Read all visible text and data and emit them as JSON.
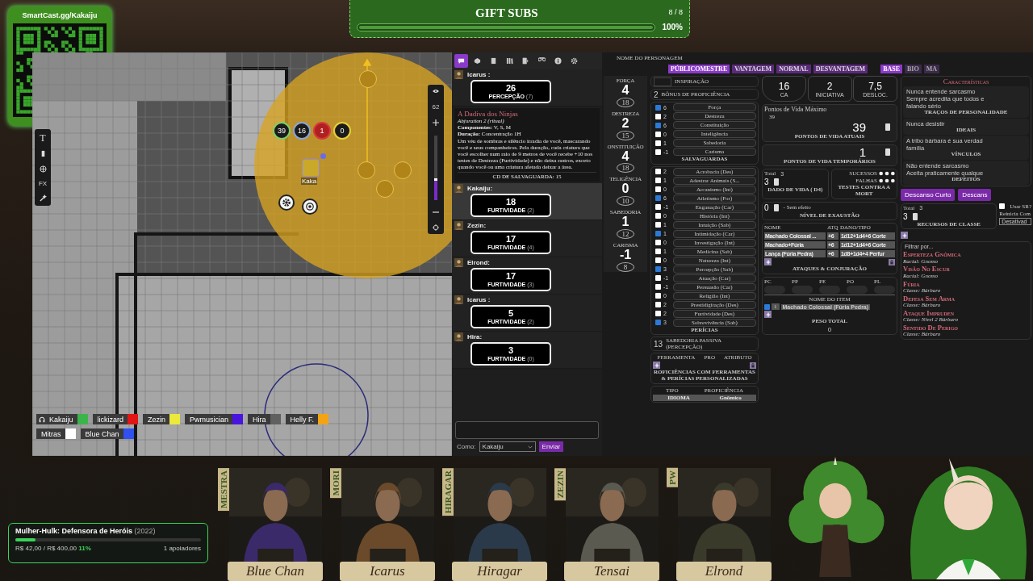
{
  "qr_card": {
    "caption": "SmartCast.gg/Kakaiju"
  },
  "gift_subs": {
    "title": "GIFT SUBS",
    "count": "8 / 8",
    "level": 1,
    "percent": "100%"
  },
  "map": {
    "tools": [
      {
        "kind": "text",
        "label": "T"
      },
      {
        "kind": "rect"
      },
      {
        "kind": "globe"
      },
      {
        "kind": "fx",
        "label": "FX"
      },
      {
        "kind": "wand"
      }
    ],
    "token_bubbles": [
      {
        "value": "39",
        "color": "#7ccf6a"
      },
      {
        "value": "16",
        "color": "#8aa6d8"
      },
      {
        "value": "1",
        "color": "#d63a3a"
      },
      {
        "value": "0",
        "color": "#e8cf3a"
      }
    ],
    "token_label": "Kaka",
    "zoom": {
      "value": "62",
      "level": 0.3
    },
    "players": [
      {
        "name": "Kakaiju",
        "color": "#3bb54a",
        "speaking": true
      },
      {
        "name": "lickizard",
        "color": "#e31414",
        "speaking": false
      },
      {
        "name": "Zezin",
        "color": "#ece83c",
        "speaking": false
      },
      {
        "name": "Pwmusician",
        "color": "#4a14e0",
        "speaking": false
      },
      {
        "name": "Hira",
        "color": "#606060",
        "speaking": false
      },
      {
        "name": "Helly F.",
        "color": "#f2a414",
        "speaking": false
      },
      {
        "name": "Mitras",
        "color": "#ffffff",
        "speaking": false
      },
      {
        "name": "Blue Chan",
        "color": "#3050f0",
        "speaking": false
      }
    ]
  },
  "chat": {
    "tabs": [
      {
        "kind": "chat",
        "selected": true
      },
      {
        "kind": "dice",
        "selected": false
      },
      {
        "kind": "journal",
        "selected": false
      },
      {
        "kind": "compendium",
        "selected": false
      },
      {
        "kind": "jukebox",
        "selected": false
      },
      {
        "kind": "collections",
        "selected": false
      },
      {
        "kind": "info",
        "selected": false
      },
      {
        "kind": "settings",
        "selected": false
      }
    ],
    "messages": [
      {
        "kind": "roll",
        "speaker": "Icarus :",
        "total": "26",
        "label": "PERCEPÇÃO",
        "mod": "(7)",
        "highlighted": false
      },
      {
        "kind": "spell",
        "title": "A Dadiva dos Ninjas",
        "subtitle": "Abjuration 2 (ritual)",
        "components": "**Componentes:** V, S, M",
        "duration": "**Duração:** Concentração 1H",
        "body": "Um véu de sombras e silêncio irradia de você, mascarando você e seus companheiros. Pela duração, cada criatura que você escolher num raio de 9 metros de você recebe +10 nos testes de Destreza (Furtividade) e não deixa rastros, exceto quando você ou uma criatura afetada deixar a área.",
        "save": "CD DE SALVAGUARDA: 15"
      },
      {
        "kind": "roll",
        "speaker": "Kakaiju:",
        "total": "18",
        "label": "FURTIVIDADE",
        "mod": "(2)",
        "highlighted": true
      },
      {
        "kind": "roll",
        "speaker": "Zezin:",
        "total": "17",
        "label": "FURTIVIDADE",
        "mod": "(4)",
        "highlighted": false
      },
      {
        "kind": "roll",
        "speaker": "Elrond:",
        "total": "17",
        "label": "FURTIVIDADE",
        "mod": "(3)",
        "highlighted": false
      },
      {
        "kind": "roll",
        "speaker": "Icarus :",
        "total": "5",
        "label": "FURTIVIDADE",
        "mod": "(2)",
        "highlighted": false
      },
      {
        "kind": "roll",
        "speaker": "Hira:",
        "total": "3",
        "label": "FURTIVIDADE",
        "mod": "(0)",
        "highlighted": false
      }
    ],
    "as_label": "Como:",
    "as_value": "Kakaiju",
    "send": "Enviar"
  },
  "sheet": {
    "name_label": "NOME DO PERSONAGEM",
    "roll_modes": [
      {
        "label": "PÚBLICOMESTRE",
        "selected": true
      },
      {
        "label": "VANTAGEM",
        "selected": false
      },
      {
        "label": "NORMAL",
        "selected": false
      },
      {
        "label": "DESVANTAGEM",
        "selected": false
      }
    ],
    "sheet_tabs": [
      {
        "label": "BASE",
        "selected": true
      },
      {
        "label": "BIO",
        "selected": false
      },
      {
        "label": "MA",
        "selected": false
      }
    ],
    "abilities": [
      {
        "name": "FORÇA",
        "mod": "4",
        "score": "18"
      },
      {
        "name": "DESTREZA",
        "mod": "2",
        "score": "15"
      },
      {
        "name": "ONSTITUIÇÃO",
        "mod": "4",
        "score": "18"
      },
      {
        "name": "TELIGÊNCIA",
        "mod": "0",
        "score": "10"
      },
      {
        "name": "SABEDORIA",
        "mod": "1",
        "score": "12"
      },
      {
        "name": "CARISMA",
        "mod": "-1",
        "score": "8"
      }
    ],
    "inspiration": "INSPIRAÇÃO",
    "proficiency": {
      "value": "2",
      "label": "BÔNUS DE PROFICIÊNCIA"
    },
    "saves": {
      "title": "SALVAGUARDAS",
      "items": [
        {
          "checked": true,
          "mod": "6",
          "name": "Força"
        },
        {
          "checked": false,
          "mod": "2",
          "name": "Destreza"
        },
        {
          "checked": true,
          "mod": "6",
          "name": "Constituição"
        },
        {
          "checked": false,
          "mod": "0",
          "name": "Inteligência"
        },
        {
          "checked": false,
          "mod": "1",
          "name": "Sabedoria"
        },
        {
          "checked": false,
          "mod": "-1",
          "name": "Carisma"
        }
      ]
    },
    "skills": {
      "title": "PERÍCIAS",
      "items": [
        {
          "checked": false,
          "mod": "2",
          "name": "Acrobacia (Des)"
        },
        {
          "checked": false,
          "mod": "1",
          "name": "Adestrar Animais (S..."
        },
        {
          "checked": false,
          "mod": "0",
          "name": "Arcanismo (Int)"
        },
        {
          "checked": true,
          "mod": "6",
          "name": "Atletismo (For)"
        },
        {
          "checked": false,
          "mod": "-1",
          "name": "Enganação (Car)"
        },
        {
          "checked": false,
          "mod": "0",
          "name": "História (Int)"
        },
        {
          "checked": false,
          "mod": "1",
          "name": "Intuição (Sab)"
        },
        {
          "checked": true,
          "mod": "1",
          "name": "Intimidação (Car)"
        },
        {
          "checked": false,
          "mod": "0",
          "name": "Investigação (Int)"
        },
        {
          "checked": false,
          "mod": "1",
          "name": "Medicina (Sab)"
        },
        {
          "checked": false,
          "mod": "0",
          "name": "Natureza (Int)"
        },
        {
          "checked": true,
          "mod": "3",
          "name": "Percepção (Sab)"
        },
        {
          "checked": false,
          "mod": "-1",
          "name": "Atuação (Car)"
        },
        {
          "checked": false,
          "mod": "-1",
          "name": "Persuasão (Car)"
        },
        {
          "checked": false,
          "mod": "0",
          "name": "Religião (Int)"
        },
        {
          "checked": false,
          "mod": "2",
          "name": "Prestidigitação (Des)"
        },
        {
          "checked": false,
          "mod": "2",
          "name": "Furtividade (Des)"
        },
        {
          "checked": true,
          "mod": "3",
          "name": "Sobrevivência (Sab)"
        }
      ]
    },
    "passive": {
      "value": "13",
      "label": "SABEDORIA PASSIVA (PERCEPÇÃO)"
    },
    "tools_columns": [
      "FERRAMENTA",
      "PRO",
      "ATRIBUTO"
    ],
    "tools_title": "ROFICIÊNCIAS COM FERRAMENTAS & PERÍCIAS PERSONALIZADAS",
    "languages": {
      "columns": [
        "TIPO",
        "PROFICIÊNCIA"
      ],
      "row": [
        "IDIOMA",
        "Gnômico"
      ]
    },
    "stats": [
      {
        "value": "16",
        "label": "CA"
      },
      {
        "value": "2",
        "label": "INICIATIVA"
      },
      {
        "value": "7,5",
        "label": "DESLOC."
      }
    ],
    "hp": {
      "max_label": "Pontos de Vida Máximo",
      "max": "39",
      "current": "39",
      "current_label": "PONTOS DE VIDA ATUAIS",
      "temp": "1",
      "temp_label": "PONTOS DE VIDA TEMPORÁRIOS"
    },
    "hit_dice": {
      "total_label": "Total",
      "total": "3",
      "value": "3",
      "label": "DADO DE VIDA ( D4)"
    },
    "death_saves": {
      "successes": "SUCESSOS",
      "failures": "FALHAS",
      "label": "TESTES CONTRA A MORT"
    },
    "exhaustion": {
      "value": "0",
      "effect": "- Sem efeito",
      "label": "NÍVEL DE EXAUSTÃO"
    },
    "attacks": {
      "columns": [
        "NOME",
        "ATQ",
        "DANO/TIPO"
      ],
      "rows": [
        [
          "Machado Colossal ...",
          "+6",
          "1d12+1d4+6 Corte"
        ],
        [
          "Machado+Fúria",
          "+6",
          "1d12+1d4+6 Corte"
        ],
        [
          "Lança (Fúria Pedra)",
          "+6",
          "1d8+1d4+4 Perfur"
        ]
      ],
      "title": "ATAQUES & CONJURAÇÃO"
    },
    "currency": [
      "PC",
      "PP",
      "PE",
      "PO",
      "PL"
    ],
    "inventory": {
      "column": "NOME DO ITEM",
      "items": [
        {
          "equipped": true,
          "count": "1",
          "name": "Machado Colossal (Fúria Pedra)"
        }
      ],
      "weight_label": "PESO TOTAL",
      "weight": "0"
    },
    "traits_title": "Características",
    "traits": [
      {
        "lines": [
          "Nunca entende sarcasmo",
          "Sempre acredita que todos e",
          "falando sério"
        ],
        "label": "TRAÇOS DE PERSONALIDADE"
      },
      {
        "lines": [
          "Nunca desistir"
        ],
        "label": "IDEAIS"
      },
      {
        "lines": [
          "A tribo bárbara é sua verdad",
          "família"
        ],
        "label": "VÍNCULOS"
      },
      {
        "lines": [
          "Não entende sarcasmo",
          "Aceita praticamente qualque"
        ],
        "label": "DEFEITOS"
      }
    ],
    "rests": [
      "Descanso Curto",
      "Descans"
    ],
    "resources": {
      "total_label": "Total",
      "total": "3",
      "value": "3",
      "label": "RECURSOS DE CLASSE",
      "use_sr": false,
      "use_label": "Usar SR?",
      "reset_label": "Reinicia Com",
      "reset_value": "Desativad"
    },
    "filter_placeholder": "Filtrar por...",
    "features": [
      {
        "name": "Esperteza Gnômica",
        "source": "Racial: Gnomo"
      },
      {
        "name": "Visão No Escur",
        "source": "Racial: Gnomo"
      },
      {
        "name": "Fúria",
        "source": "Classe: Bárbaro"
      },
      {
        "name": "Defesa Sem Arma",
        "source": "Classe: Bárbaro"
      },
      {
        "name": "Ataque Impruden",
        "source": "Classe: Nível 2 Bárbaro"
      },
      {
        "name": "Sentido De Perigo",
        "source": "Classe: Bárbaro"
      }
    ]
  },
  "donation": {
    "title": "Mulher-Hulk: Defensora de Heróis",
    "year": "(2022)",
    "amount": "R$ 42,00 / R$ 400,00",
    "percent": "11%",
    "level": 0.11,
    "supporters": "1 apoiadores"
  },
  "party": [
    {
      "tag": "MESTRA",
      "name": "Blue Chan"
    },
    {
      "tag": "MORI",
      "name": "Icarus"
    },
    {
      "tag": "HIRAGAR",
      "name": "Hiragar"
    },
    {
      "tag": "ZEZIN",
      "name": "Tensai"
    },
    {
      "tag": "PW",
      "name": "Elrond"
    }
  ]
}
